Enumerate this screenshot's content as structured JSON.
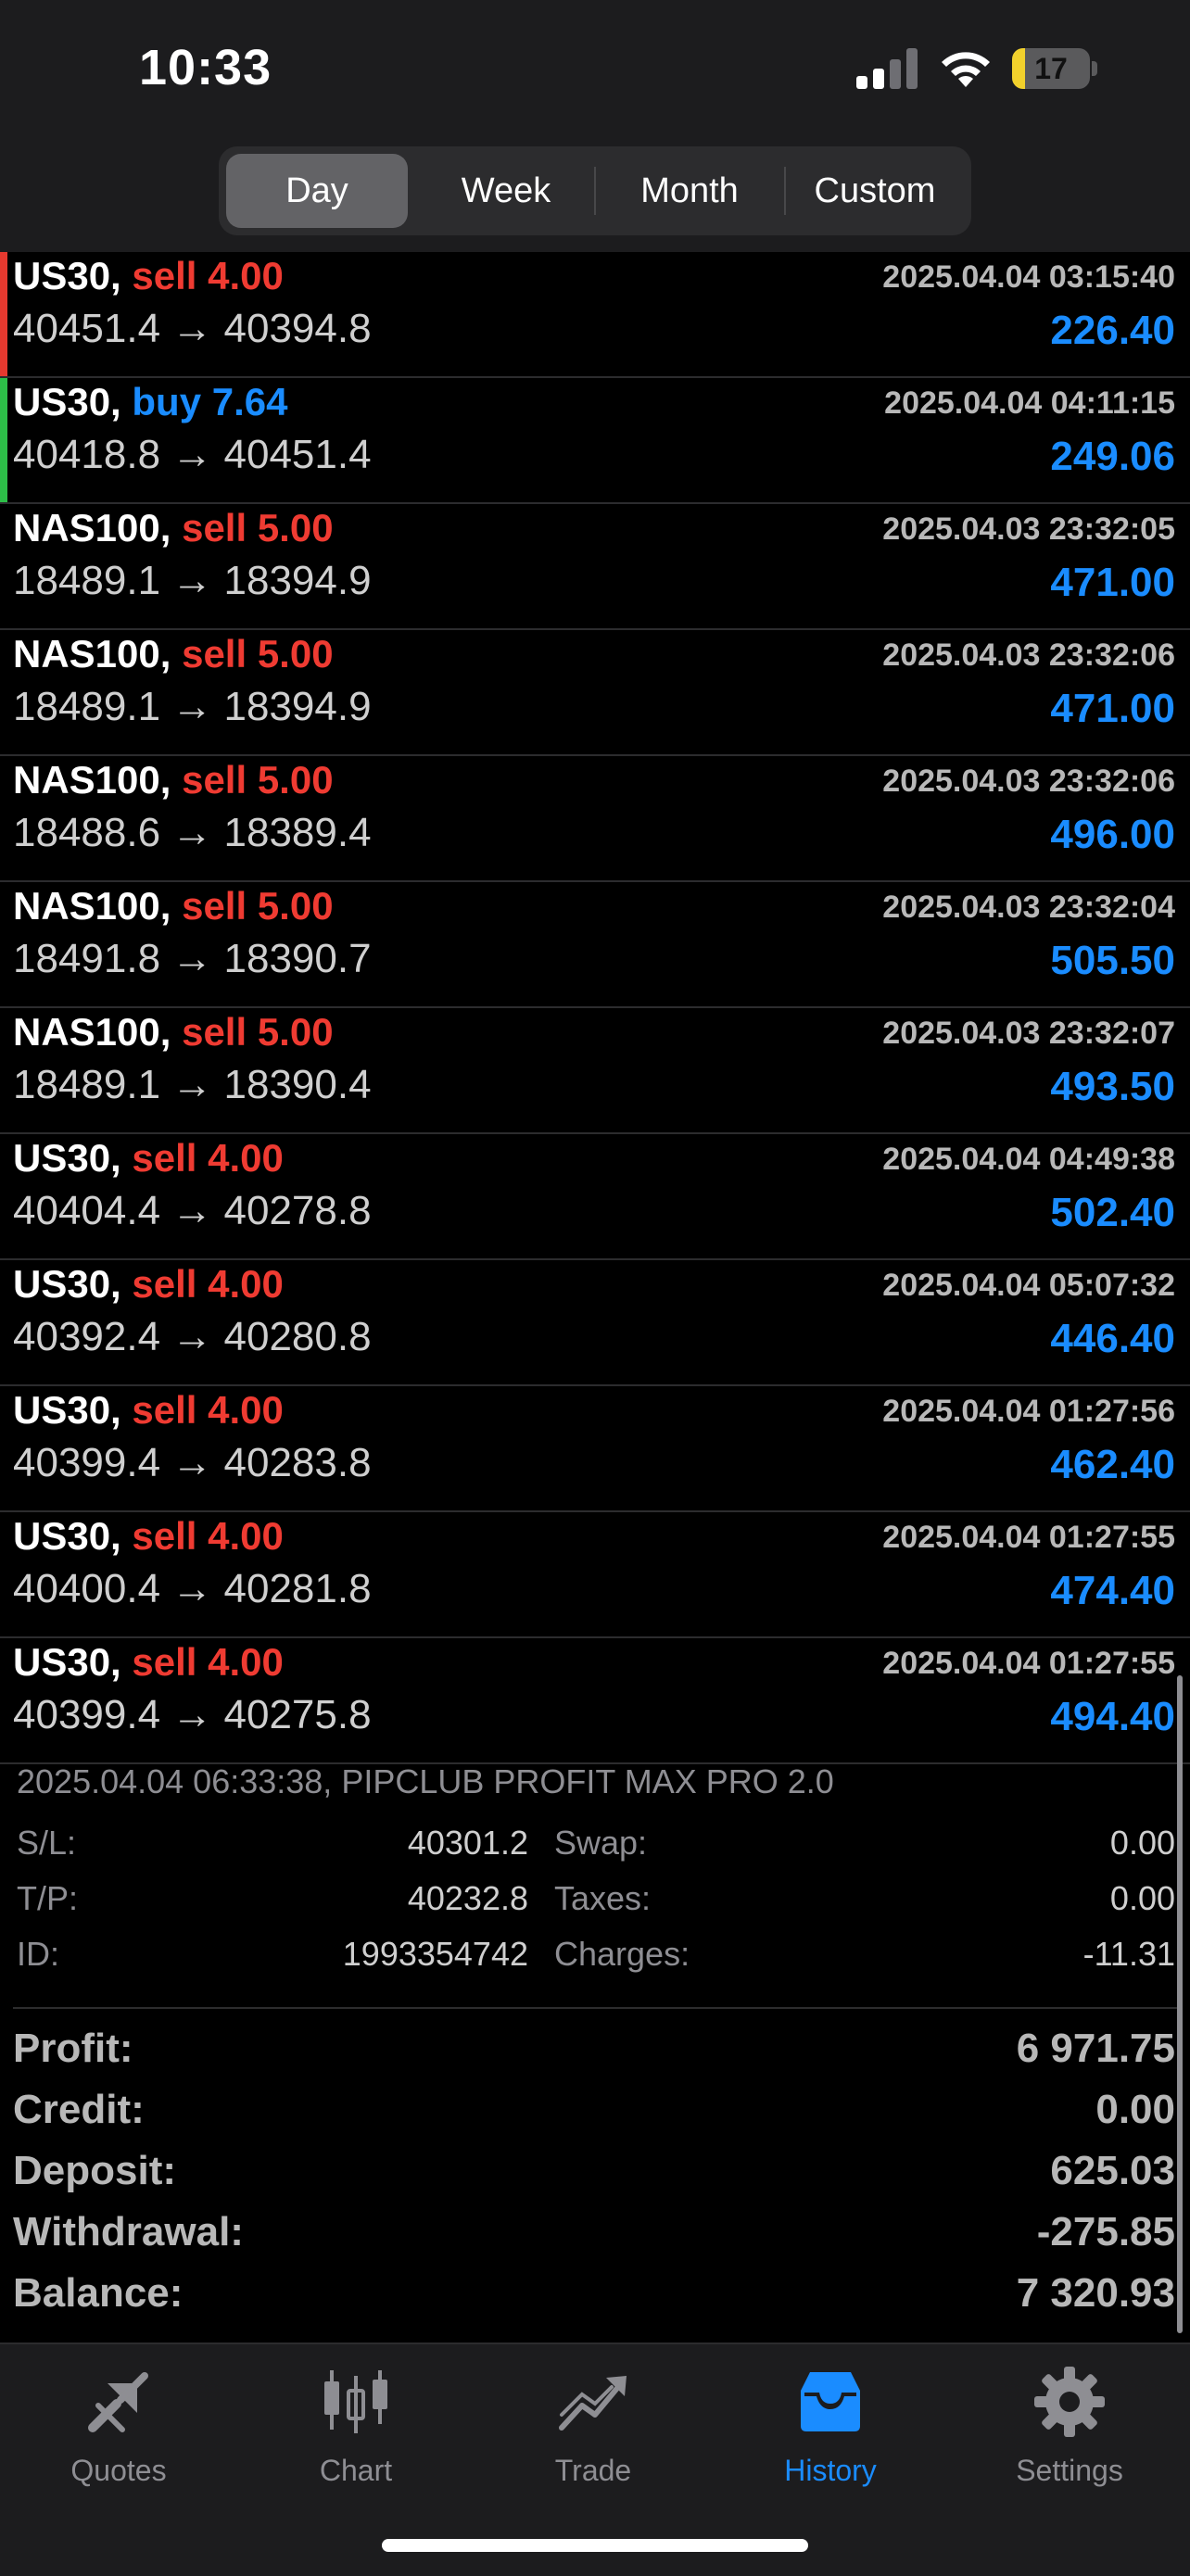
{
  "status": {
    "time": "10:33",
    "battery": "17",
    "battery_level": 0.17
  },
  "segments": [
    {
      "label": "Day",
      "active": true
    },
    {
      "label": "Week",
      "active": false
    },
    {
      "label": "Month",
      "active": false
    },
    {
      "label": "Custom",
      "active": false
    }
  ],
  "trades": [
    {
      "symbol": "US30,",
      "direction": "sell",
      "volume": "4.00",
      "time": "2025.04.04 03:15:40",
      "open": "40451.4",
      "close": "40394.8",
      "profit": "226.40",
      "accent": "red"
    },
    {
      "symbol": "US30,",
      "direction": "buy",
      "volume": "7.64",
      "time": "2025.04.04 04:11:15",
      "open": "40418.8",
      "close": "40451.4",
      "profit": "249.06",
      "accent": "green"
    },
    {
      "symbol": "NAS100,",
      "direction": "sell",
      "volume": "5.00",
      "time": "2025.04.03 23:32:05",
      "open": "18489.1",
      "close": "18394.9",
      "profit": "471.00",
      "accent": ""
    },
    {
      "symbol": "NAS100,",
      "direction": "sell",
      "volume": "5.00",
      "time": "2025.04.03 23:32:06",
      "open": "18489.1",
      "close": "18394.9",
      "profit": "471.00",
      "accent": ""
    },
    {
      "symbol": "NAS100,",
      "direction": "sell",
      "volume": "5.00",
      "time": "2025.04.03 23:32:06",
      "open": "18488.6",
      "close": "18389.4",
      "profit": "496.00",
      "accent": ""
    },
    {
      "symbol": "NAS100,",
      "direction": "sell",
      "volume": "5.00",
      "time": "2025.04.03 23:32:04",
      "open": "18491.8",
      "close": "18390.7",
      "profit": "505.50",
      "accent": ""
    },
    {
      "symbol": "NAS100,",
      "direction": "sell",
      "volume": "5.00",
      "time": "2025.04.03 23:32:07",
      "open": "18489.1",
      "close": "18390.4",
      "profit": "493.50",
      "accent": ""
    },
    {
      "symbol": "US30,",
      "direction": "sell",
      "volume": "4.00",
      "time": "2025.04.04 04:49:38",
      "open": "40404.4",
      "close": "40278.8",
      "profit": "502.40",
      "accent": ""
    },
    {
      "symbol": "US30,",
      "direction": "sell",
      "volume": "4.00",
      "time": "2025.04.04 05:07:32",
      "open": "40392.4",
      "close": "40280.8",
      "profit": "446.40",
      "accent": ""
    },
    {
      "symbol": "US30,",
      "direction": "sell",
      "volume": "4.00",
      "time": "2025.04.04 01:27:56",
      "open": "40399.4",
      "close": "40283.8",
      "profit": "462.40",
      "accent": ""
    },
    {
      "symbol": "US30,",
      "direction": "sell",
      "volume": "4.00",
      "time": "2025.04.04 01:27:55",
      "open": "40400.4",
      "close": "40281.8",
      "profit": "474.40",
      "accent": ""
    },
    {
      "symbol": "US30,",
      "direction": "sell",
      "volume": "4.00",
      "time": "2025.04.04 01:27:55",
      "open": "40399.4",
      "close": "40275.8",
      "profit": "494.40",
      "accent": ""
    }
  ],
  "arrow": "→",
  "details": {
    "title": "2025.04.04 06:33:38, PIPCLUB PROFIT MAX PRO 2.0",
    "sl_label": "S/L:",
    "sl": "40301.2",
    "tp_label": "T/P:",
    "tp": "40232.8",
    "id_label": "ID:",
    "id": "1993354742",
    "swap_label": "Swap:",
    "swap": "0.00",
    "taxes_label": "Taxes:",
    "taxes": "0.00",
    "charges_label": "Charges:",
    "charges": "-11.31"
  },
  "summary": [
    {
      "label": "Profit:",
      "value": "6 971.75"
    },
    {
      "label": "Credit:",
      "value": "0.00"
    },
    {
      "label": "Deposit:",
      "value": "625.03"
    },
    {
      "label": "Withdrawal:",
      "value": "-275.85"
    },
    {
      "label": "Balance:",
      "value": "7 320.93"
    }
  ],
  "tabs": [
    {
      "label": "Quotes",
      "icon": "quotes-icon",
      "active": false
    },
    {
      "label": "Chart",
      "icon": "chart-icon",
      "active": false
    },
    {
      "label": "Trade",
      "icon": "trade-icon",
      "active": false
    },
    {
      "label": "History",
      "icon": "history-icon",
      "active": true
    },
    {
      "label": "Settings",
      "icon": "gear-icon",
      "active": false
    }
  ],
  "colors": {
    "sell": "#ef3b32",
    "buy": "#1a8cff",
    "profit": "#1a8cff",
    "accent_active": "#1a8cff",
    "tab_inactive": "#8e8e93"
  }
}
